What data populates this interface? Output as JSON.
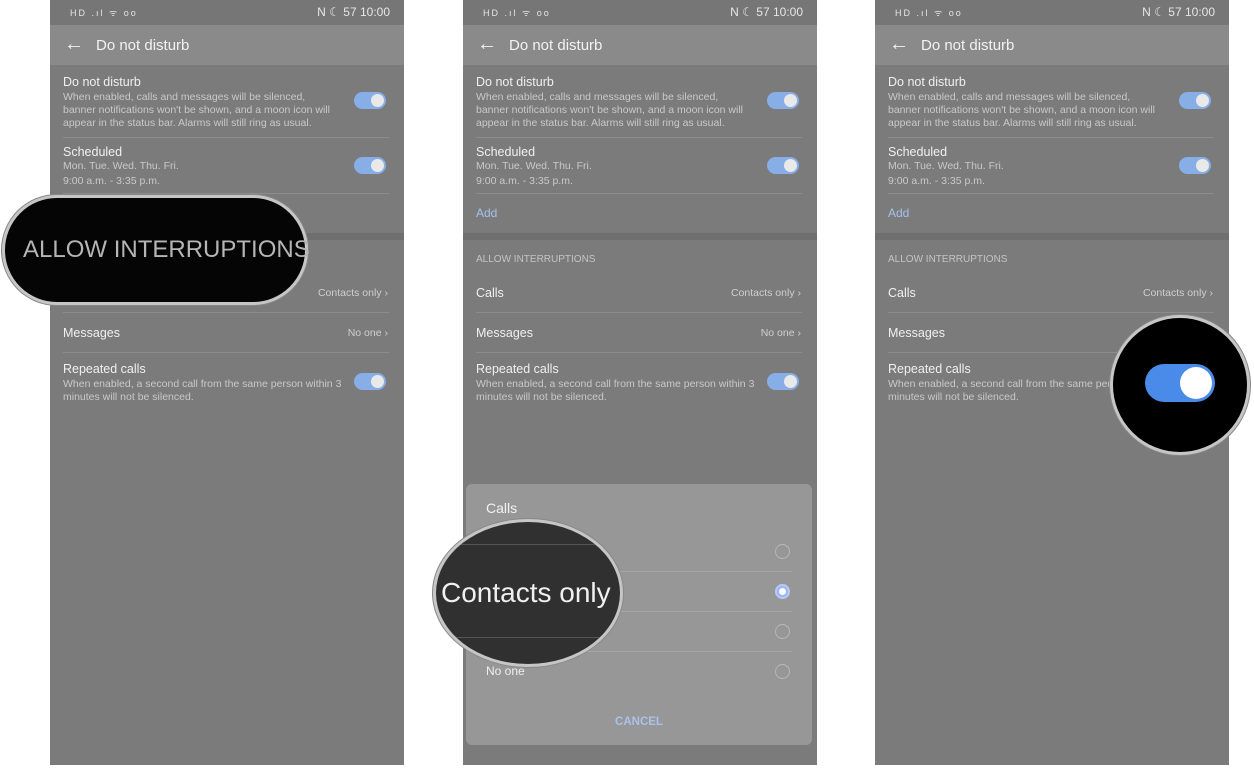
{
  "status_bar": {
    "left_icons": "HD .ıl ᯤ oo",
    "right_icons": "N ☾ 57",
    "time": "10:00"
  },
  "header": {
    "back_icon": "arrow-left-icon",
    "title": "Do not disturb"
  },
  "settings": {
    "dnd": {
      "title": "Do not disturb",
      "description": "When enabled, calls and messages will be silenced, banner notifications won't be shown, and a moon icon will appear in the status bar. Alarms will still ring as usual.",
      "enabled": true
    },
    "scheduled": {
      "title": "Scheduled",
      "days": "Mon. Tue. Wed. Thu. Fri.",
      "time": "9:00 a.m. - 3:35 p.m.",
      "enabled": true
    },
    "add_label": "Add",
    "section_header": "ALLOW INTERRUPTIONS",
    "calls": {
      "title": "Calls",
      "value": "Contacts only"
    },
    "messages": {
      "title": "Messages",
      "value": "No one"
    },
    "repeated": {
      "title": "Repeated calls",
      "description": "When enabled, a second call from the same person within 3 minutes will not be silenced.",
      "enabled": true
    }
  },
  "dialog": {
    "title": "Calls",
    "options": [
      {
        "label": "",
        "selected": false
      },
      {
        "label": "Contacts only",
        "selected": true
      },
      {
        "label": "",
        "selected": false
      },
      {
        "label": "No one",
        "selected": false
      }
    ],
    "cancel": "CANCEL"
  },
  "magnifiers": {
    "panel1": "ALLOW INTERRUPTIONS",
    "panel2": "Contacts only",
    "panel3_toggle_on": true
  },
  "colors": {
    "toggle_on": "#4a8ae8",
    "accent": "#a6c1ec"
  }
}
